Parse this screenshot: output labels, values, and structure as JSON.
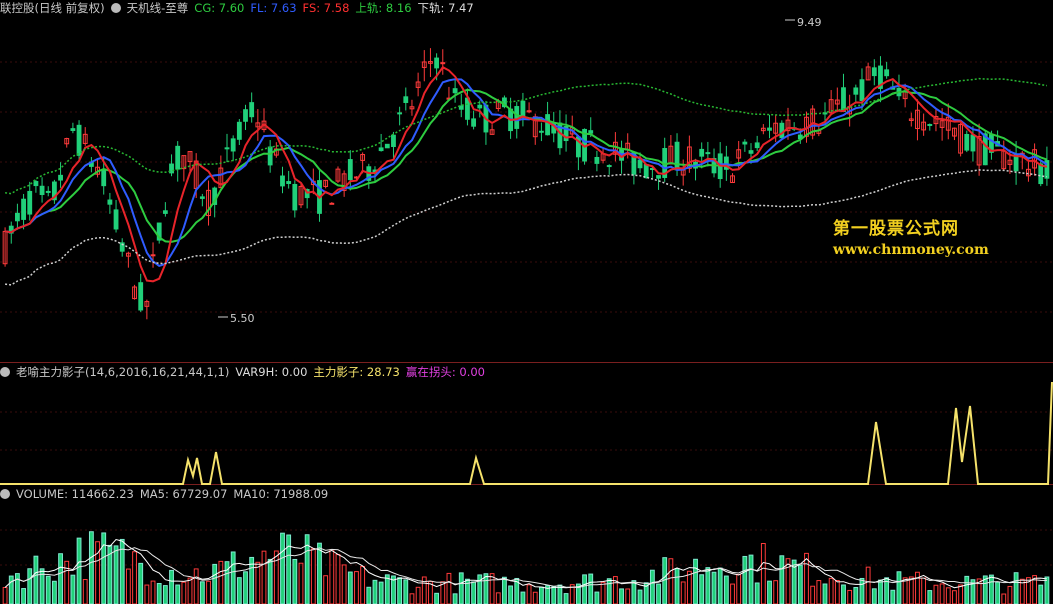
{
  "chart_data": [
    {
      "type": "candlestick",
      "title": "联控股(日线 前复权)",
      "indicator_name": "天机线-至尊",
      "indicators": [
        {
          "label": "CG: 7.60",
          "color": "#2ecc40"
        },
        {
          "label": "FL: 7.63",
          "color": "#2f5cff"
        },
        {
          "label": "FS: 7.58",
          "color": "#ff3030"
        },
        {
          "label": "上轨: 8.16",
          "color": "#2ecc40"
        },
        {
          "label": "下轨: 7.47",
          "color": "#dddddd"
        }
      ],
      "annotations": {
        "high": "9.49",
        "low": "5.50"
      },
      "ylim": [
        5.0,
        9.8
      ],
      "n_bars": 170,
      "colors": {
        "up": "#ff3b3b",
        "down": "#21d07a",
        "cg": "#2ecc40",
        "fl": "#2f5cff",
        "fs": "#e8242a",
        "upper": "#28b832",
        "lower": "#cfcfcf"
      }
    },
    {
      "type": "line",
      "title": "老喻主力影子(14,6,2016,16,21,44,1,1)",
      "values_text": [
        {
          "label": "VAR9H: 0.00",
          "color": "#dddddd"
        },
        {
          "label": "主力影子: 28.73",
          "color": "#f5e26b"
        },
        {
          "label": "赢在拐头: 0.00",
          "color": "#e040e0"
        }
      ],
      "series": [
        {
          "name": "主力影子",
          "color": "#f5e26b"
        }
      ]
    },
    {
      "type": "bar",
      "title": "VOLUME: 114662.23",
      "values_text": [
        {
          "label": "MA5: 67729.07",
          "color": "#dddddd"
        },
        {
          "label": "MA10: 71988.09",
          "color": "#dddddd"
        }
      ]
    }
  ],
  "watermark": {
    "line1": "第一股票公式网",
    "line2": "www.chnmoney.com"
  }
}
